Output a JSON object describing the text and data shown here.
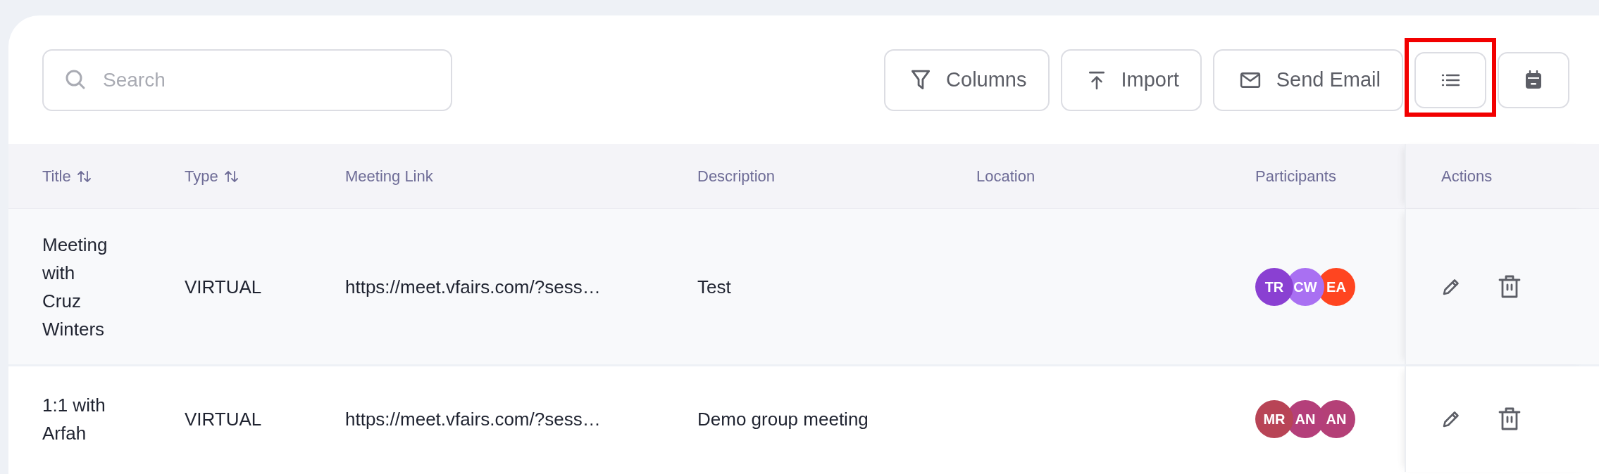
{
  "search": {
    "placeholder": "Search"
  },
  "toolbar": [
    {
      "kind": "labeled",
      "label": "Columns",
      "highlighted": false
    },
    {
      "kind": "labeled",
      "label": "Import",
      "highlighted": false
    },
    {
      "kind": "labeled",
      "label": "Send Email",
      "highlighted": false
    },
    {
      "kind": "icon",
      "highlighted": true
    },
    {
      "kind": "icon",
      "highlighted": false
    }
  ],
  "table": {
    "columns": [
      {
        "label": "Title",
        "sortable": true
      },
      {
        "label": "Type",
        "sortable": true
      },
      {
        "label": "Meeting Link",
        "sortable": false
      },
      {
        "label": "Description",
        "sortable": false
      },
      {
        "label": "Location",
        "sortable": false
      },
      {
        "label": "Participants",
        "sortable": false
      },
      {
        "label": "Actions",
        "sortable": false
      }
    ],
    "rows": [
      {
        "title": "Meeting with Cruz Winters",
        "type": "VIRTUAL",
        "meeting_link": "https://meet.vfairs.com/?sess…",
        "description": "Test",
        "participants": [
          {
            "initials": "TR",
            "color": "#8a40d2"
          },
          {
            "initials": "CW",
            "color": "#a970f2"
          },
          {
            "initials": "EA",
            "color": "#ff4520"
          }
        ]
      },
      {
        "title": "1:1 with Arfah",
        "type": "VIRTUAL",
        "meeting_link": "https://meet.vfairs.com/?sess…",
        "description": "Demo group meeting",
        "participants": [
          {
            "initials": "MR",
            "color": "#b84456"
          },
          {
            "initials": "AN",
            "color": "#b43f7a"
          },
          {
            "initials": "AN",
            "color": "#b44077"
          }
        ]
      }
    ]
  }
}
